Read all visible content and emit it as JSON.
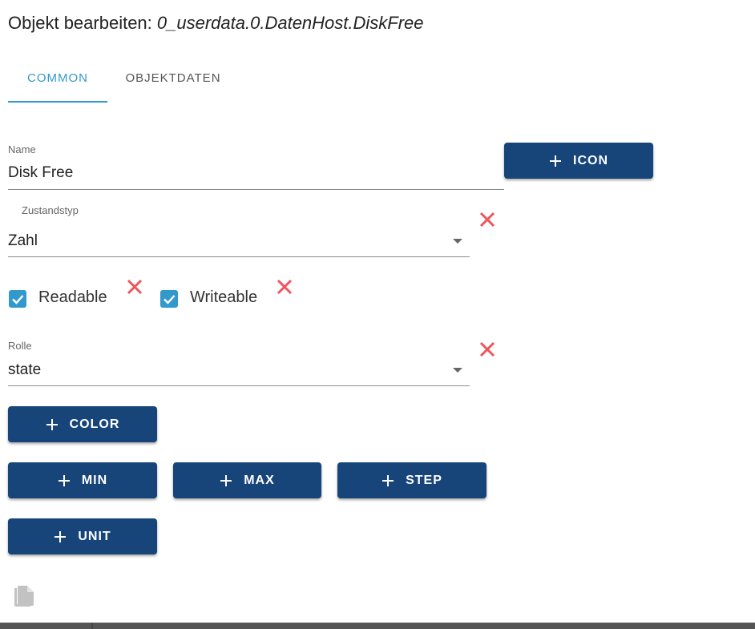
{
  "title": {
    "prefix": "Objekt bearbeiten: ",
    "object_id": "0_userdata.0.DatenHost.DiskFree"
  },
  "tabs": [
    {
      "label": "Common",
      "active": true
    },
    {
      "label": "Objektdaten",
      "active": false
    }
  ],
  "form": {
    "name": {
      "label": "Name",
      "value": "Disk Free"
    },
    "state_type": {
      "label": "Zustandstyp",
      "value": "Zahl"
    },
    "readable": {
      "label": "Readable",
      "checked": true
    },
    "writeable": {
      "label": "Writeable",
      "checked": true
    },
    "role": {
      "label": "Rolle",
      "value": "state"
    }
  },
  "buttons": {
    "icon": "Icon",
    "color": "Color",
    "min": "Min",
    "max": "Max",
    "step": "Step",
    "unit": "Unit"
  },
  "colors": {
    "accent": "#3399cc",
    "button": "#174479",
    "delete": "#f0545c"
  },
  "icons": {
    "delete": "close-icon",
    "add": "plus-icon",
    "dropdown": "arrow-drop-down-icon",
    "copy": "copy-icon",
    "check": "check-icon"
  }
}
